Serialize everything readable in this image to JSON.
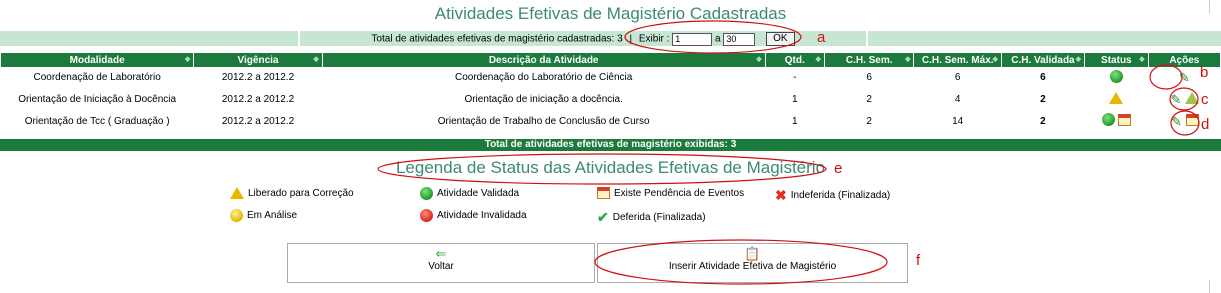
{
  "page_title": "Atividades Efetivas de Magistério Cadastradas",
  "summary": {
    "total_label": "Total de atividades efetivas de magistério cadastradas: 3",
    "separator": "|",
    "exibir_label": "Exibir :",
    "from_value": "1",
    "to_label": "a",
    "to_value": "30",
    "ok_label": "OK"
  },
  "table": {
    "columns": [
      "Modalidade",
      "Vigência",
      "Descrição da Atividade",
      "Qtd.",
      "C.H. Sem.",
      "C.H. Sem. Máx.",
      "C.H. Validada",
      "Status",
      "Ações"
    ],
    "rows": [
      {
        "modalidade": "Coordenação de Laboratório",
        "vigencia": "2012.2 a 2012.2",
        "descricao": "Coordenação do Laboratório de Ciência",
        "qtd": "-",
        "ch_sem": "6",
        "ch_max": "6",
        "ch_val": "6"
      },
      {
        "modalidade": "Orientação de Iniciação à Docência",
        "vigencia": "2012.2 a 2012.2",
        "descricao": "Orientação de iniciação a docência.",
        "qtd": "1",
        "ch_sem": "2",
        "ch_max": "4",
        "ch_val": "2"
      },
      {
        "modalidade": "Orientação de Tcc ( Graduação )",
        "vigencia": "2012.2 a 2012.2",
        "descricao": "Orientação de Trabalho de Conclusão de Curso",
        "qtd": "1",
        "ch_sem": "2",
        "ch_max": "14",
        "ch_val": "2"
      }
    ],
    "footer": "Total de atividades efetivas de magistério exibidas: 3"
  },
  "legend": {
    "title": "Legenda de Status das Atividades Efetivas de Magistério",
    "items": {
      "liberado": "Liberado para Correção",
      "validada": "Atividade Validada",
      "pendencia": "Existe Pendência de Eventos",
      "indeferida": "Indeferida (Finalizada)",
      "analise": "Em Análise",
      "invalidada": "Atividade Invalidada",
      "deferida": "Deferida (Finalizada)"
    }
  },
  "buttons": {
    "voltar": "Voltar",
    "inserir": "Inserir Atividade Efetiva de Magistério"
  },
  "annotations": [
    "a",
    "b",
    "c",
    "d",
    "e",
    "f"
  ],
  "colors": {
    "header_green": "#1c7a3c",
    "light_green": "#c6e6d2",
    "title_teal": "#3c8a72",
    "annotation_red": "#d01010"
  }
}
